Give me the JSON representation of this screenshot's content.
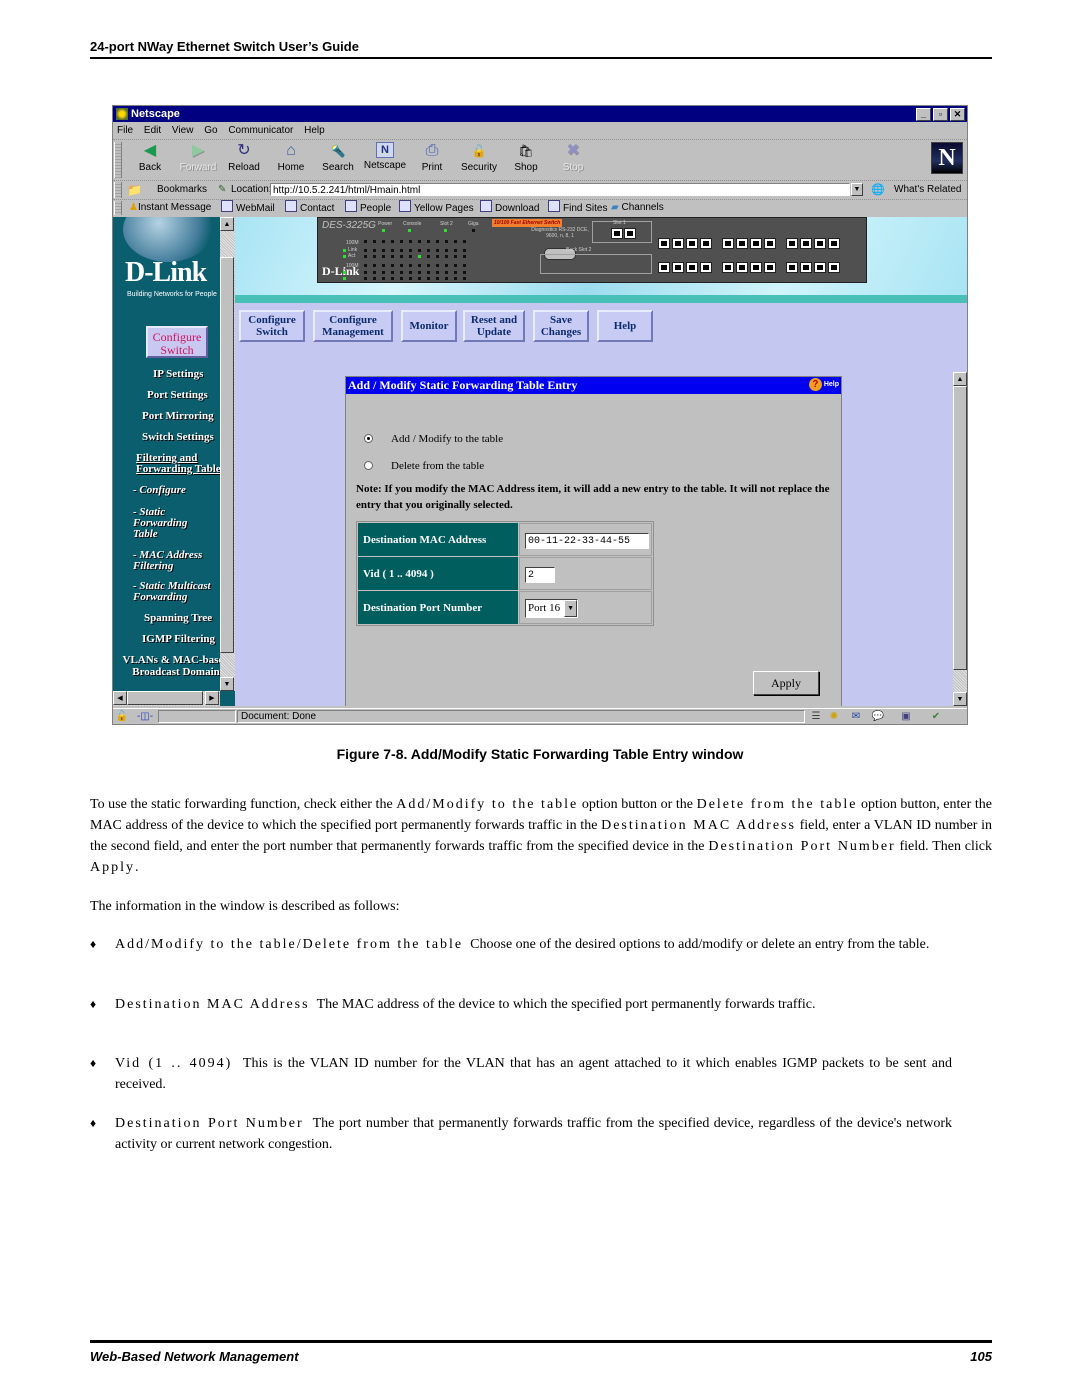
{
  "doc": {
    "header": "24-port NWay Ethernet Switch User’s Guide",
    "footer_left": "Web-Based Network Management",
    "page_number": "105",
    "caption": "Figure 7-8.  Add/Modify Static Forwarding Table Entry window",
    "para1": {
      "t1": "To use the static forwarding function, check either the ",
      "k1": "Add/Modify to the table",
      "t2": " option button or the ",
      "k2": "Delete from the table",
      "t3": " option button, enter the MAC address of the device to which the specified port permanently forwards traffic in the ",
      "k3": "Destination MAC Address",
      "t4": " field, enter a VLAN ID number in the second field, and enter the port number that permanently forwards traffic from the specified device in the ",
      "k4": "Destination Port Number",
      "t5": " field. Then click ",
      "k5": "Apply",
      "t6": "."
    },
    "para2": "The information in the window is described as follows:",
    "bullets": [
      {
        "term": "Add/Modify to the table/Delete from the table",
        "desc": "Choose one of the desired options  to add/modify or delete an entry from the table."
      },
      {
        "term": "Destination MAC Address",
        "desc": "The MAC address of the device to which the specified port permanently forwards traffic."
      },
      {
        "term": "Vid (1 .. 4094)",
        "desc": "This is the VLAN ID number for the VLAN that has an agent attached to it which enables IGMP packets to be sent and received."
      },
      {
        "term": "Destination Port Number",
        "desc": "The port number that permanently forwards traffic from the specified device, regardless of the device's network activity or current network congestion."
      }
    ],
    "bullet_glyph": "♦"
  },
  "browser": {
    "title": "Netscape",
    "window_buttons": {
      "minimize": "_",
      "maximize": "▫",
      "close": "✕"
    },
    "menu": [
      "File",
      "Edit",
      "View",
      "Go",
      "Communicator",
      "Help"
    ],
    "nav_buttons": [
      {
        "label": "Back",
        "icon": "◀",
        "enabled": true
      },
      {
        "label": "Forward",
        "icon": "▶",
        "enabled": false
      },
      {
        "label": "Reload",
        "icon": "↻",
        "enabled": true
      },
      {
        "label": "Home",
        "icon": "⌂",
        "enabled": true
      },
      {
        "label": "Search",
        "icon": "🔦",
        "enabled": true
      },
      {
        "label": "Netscape",
        "icon": "N",
        "enabled": true
      },
      {
        "label": "Print",
        "icon": "⎙",
        "enabled": true
      },
      {
        "label": "Security",
        "icon": "🔓",
        "enabled": true
      },
      {
        "label": "Shop",
        "icon": "🛍",
        "enabled": true
      },
      {
        "label": "Stop",
        "icon": "✖",
        "enabled": false
      }
    ],
    "logo": "N",
    "bookmarks_label": "Bookmarks",
    "location_label": "Location:",
    "url": "http://10.5.2.241/html/Hmain.html",
    "whats_related": "What's Related",
    "personal_toolbar": [
      "Instant Message",
      "WebMail",
      "Contact",
      "People",
      "Yellow Pages",
      "Download",
      "Find Sites",
      "Channels"
    ],
    "status_text": "Document: Done"
  },
  "sidebar": {
    "brand": "D-Link",
    "tagline": "Building Networks for People",
    "section_button": "Configure Switch",
    "items": [
      {
        "label": "IP Settings"
      },
      {
        "label": "Port Settings"
      },
      {
        "label": "Port Mirroring"
      },
      {
        "label": "Switch Settings"
      },
      {
        "label": "Filtering and Forwarding Table"
      },
      {
        "label": "- Configure"
      },
      {
        "label": "- Static Forwarding Table"
      },
      {
        "label": "- MAC Address Filtering"
      },
      {
        "label": "- Static Multicast Forwarding"
      },
      {
        "label": "Spanning Tree"
      },
      {
        "label": "IGMP Filtering"
      },
      {
        "label": "VLANs & MAC-based Broadcast Domain"
      }
    ]
  },
  "device": {
    "model": "DES-3225G",
    "labels": {
      "power": "Power",
      "console": "Console",
      "slot2": "Slot 2",
      "giga": "Giga",
      "badge": "10/100 Fast Ethernet Switch",
      "diag": "Diagnostics RS-232 DCE, 9600, n, 8, 1",
      "slot1": "Slot 1",
      "back_slot2": "Back Slot 2",
      "speed": "100M",
      "link": "Link",
      "act": "Act",
      "brand": "D-Link"
    }
  },
  "topnav": [
    {
      "label": "Configure Switch"
    },
    {
      "label": "Configure Management"
    },
    {
      "label": "Monitor"
    },
    {
      "label": "Reset and Update"
    },
    {
      "label": "Save Changes"
    },
    {
      "label": "Help"
    }
  ],
  "form": {
    "title": "Add / Modify Static Forwarding Table Entry",
    "help_label": "Help",
    "help_icon": "?",
    "options": [
      {
        "label": "Add / Modify to the table",
        "checked": true
      },
      {
        "label": "Delete from the table",
        "checked": false
      }
    ],
    "note": "Note: If you modify the MAC Address item, it will add a new entry to the table. It will not replace the entry that you originally selected.",
    "fields": {
      "mac_label": "Destination MAC Address",
      "mac_value": "00-11-22-33-44-55",
      "vid_label": "Vid ( 1 .. 4094 )",
      "vid_value": "2",
      "port_label": "Destination Port Number",
      "port_value": "Port 16"
    },
    "apply": "Apply"
  }
}
